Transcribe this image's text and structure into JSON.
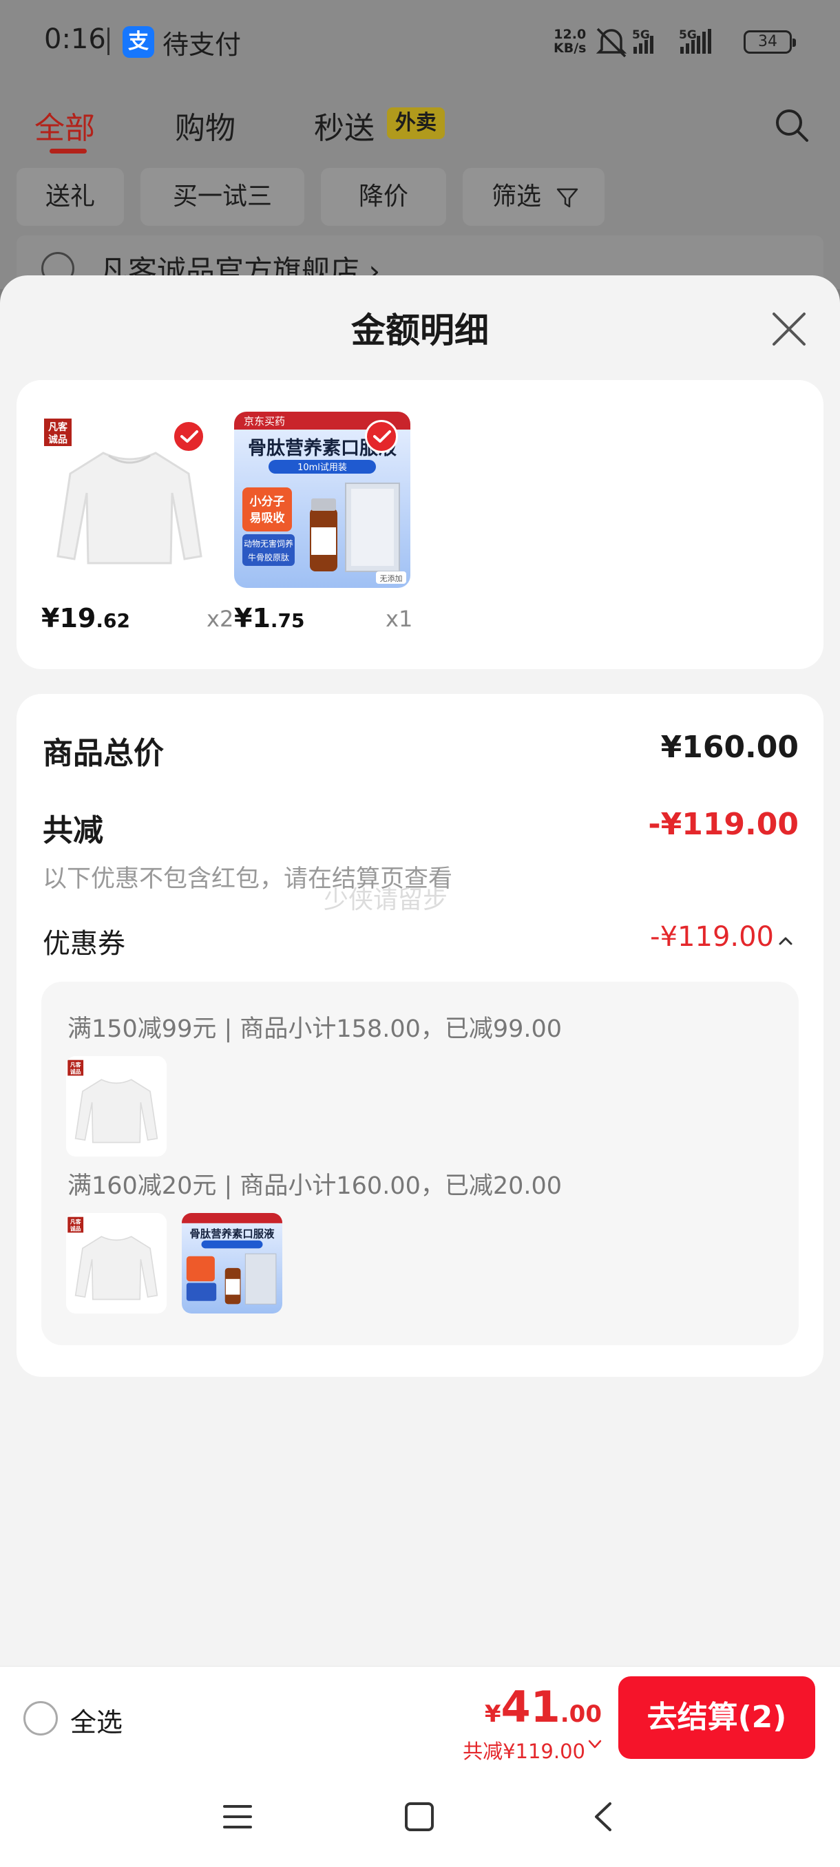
{
  "status_bar": {
    "time": "0:16",
    "app_icon_glyph": "支",
    "app_text": "待支付",
    "net_speed_value": "12.0",
    "net_speed_unit": "KB/s",
    "signal1": "5G",
    "signal2": "5G",
    "battery": "34"
  },
  "background": {
    "tabs": [
      "全部",
      "购物",
      "秒送"
    ],
    "tab_badge": "外卖",
    "filters": [
      "送礼",
      "买一试三",
      "降价",
      "筛选"
    ],
    "store_name": "凡客诚品官方旗舰店 ›"
  },
  "sheet": {
    "title": "金额明细",
    "products": [
      {
        "price_int": "¥19",
        "price_dec": ".62",
        "qty": "x2",
        "brand_tag": "凡客诚品"
      },
      {
        "price_int": "¥1",
        "price_dec": ".75",
        "qty": "x1",
        "headline": "骨肽营养素口服液",
        "sub": "10ml试用装",
        "badge1": "小分子",
        "badge2": "易吸收",
        "tagline": "动物无害饲养",
        "tagline2": "牛骨胶原肽",
        "store": "京东买药",
        "note": "无添加"
      }
    ],
    "total_label": "商品总价",
    "total_value": "¥160.00",
    "reduce_label": "共减",
    "reduce_value": "-¥119.00",
    "hint": "以下优惠不包含红包，请在结算页查看",
    "watermark": "少侠请留步",
    "coupon_label": "优惠券",
    "coupon_value": "-¥119.00",
    "coupon_lines": [
      "满150减99元 | 商品小计158.00，已减99.00",
      "满160减20元 | 商品小计160.00，已减20.00"
    ]
  },
  "action_bar": {
    "select_all": "全选",
    "currency": "¥",
    "amount_int": "41",
    "amount_dec": ".00",
    "reduce_summary": "共减¥119.00",
    "pay_button": "去结算(2)"
  },
  "colors": {
    "accent_red": "#e4272b",
    "pay_button": "#f5142a",
    "tab_active": "#b3221a"
  },
  "icons": [
    "alipay-icon",
    "mute-bell-icon",
    "signal-icon",
    "battery-icon",
    "search-icon",
    "filter-icon",
    "close-icon",
    "check-icon",
    "chevron-up-icon",
    "chevron-down-icon",
    "menu-icon",
    "home-icon",
    "back-icon"
  ]
}
